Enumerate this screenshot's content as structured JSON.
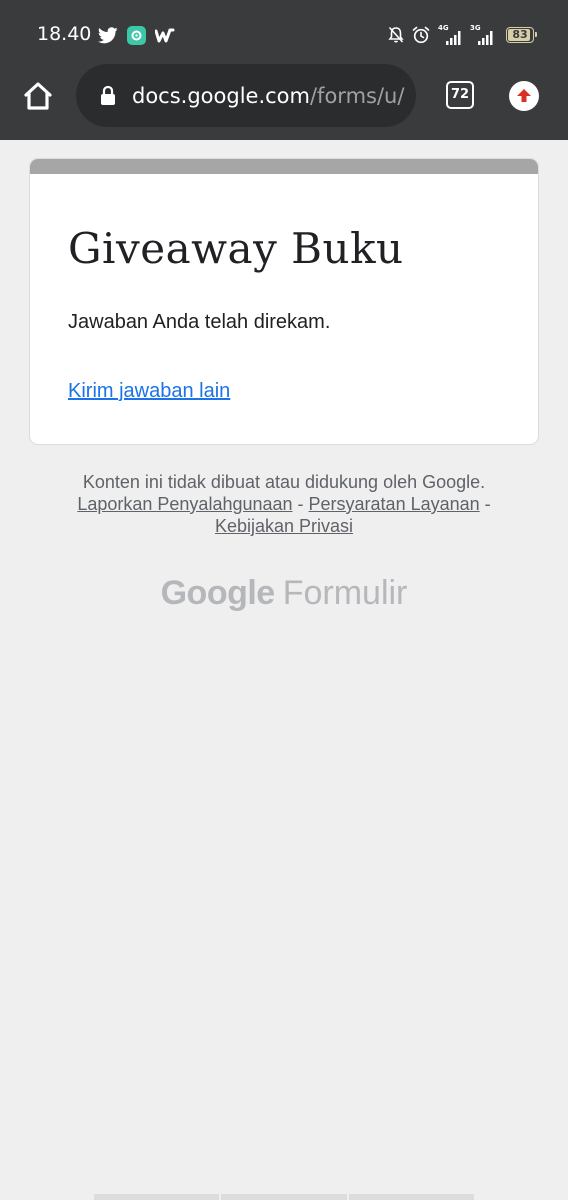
{
  "status_bar": {
    "time": "18.40",
    "network_1": "4G",
    "network_2": "3G",
    "battery": "83"
  },
  "browser": {
    "url_domain": "docs.google.com",
    "url_path": "/forms/u/",
    "tab_count": "72"
  },
  "form": {
    "title": "Giveaway Buku",
    "confirmation": "Jawaban Anda telah direkam.",
    "resubmit_link": "Kirim jawaban lain",
    "accent_color": "#a6a6a6"
  },
  "footer": {
    "disclaimer": "Konten ini tidak dibuat atau didukung oleh Google.",
    "links": [
      "Laporkan Penyalahgunaan",
      "Persyaratan Layanan",
      "Kebijakan Privasi"
    ],
    "separator": " - "
  },
  "brand": {
    "google": "Google",
    "product": "Formulir"
  }
}
